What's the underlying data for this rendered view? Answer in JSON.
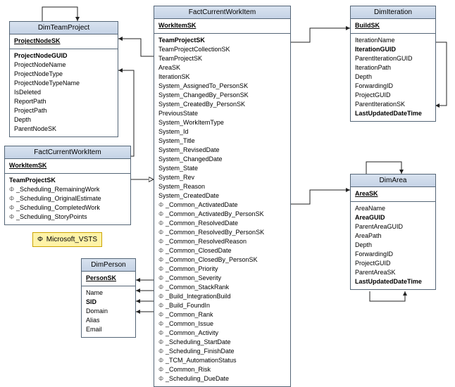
{
  "legend": {
    "phi": "Φ",
    "label": "Microsoft_VSTS"
  },
  "entities": {
    "dimTeamProject": {
      "title": "DimTeamProject",
      "pk": [
        "ProjectNodeSK"
      ],
      "fields": [
        {
          "name": "ProjectNodeGUID",
          "bold": true
        },
        {
          "name": "ProjectNodeName"
        },
        {
          "name": "ProjectNodeType"
        },
        {
          "name": "ProjectNodeTypeName"
        },
        {
          "name": "IsDeleted"
        },
        {
          "name": "ReportPath"
        },
        {
          "name": "ProjectPath"
        },
        {
          "name": "Depth"
        },
        {
          "name": "ParentNodeSK"
        }
      ]
    },
    "factCurrentWorkItemSmall": {
      "title": "FactCurrentWorkItem",
      "pk": [
        "WorkItemSK"
      ],
      "fields": [
        {
          "name": "TeamProjectSK",
          "bold": true
        },
        {
          "name": "_Scheduling_RemainingWork",
          "phi": true
        },
        {
          "name": "_Scheduling_OriginalEstimate",
          "phi": true
        },
        {
          "name": "_Scheduling_CompletedWork",
          "phi": true
        },
        {
          "name": "_Scheduling_StoryPoints",
          "phi": true
        }
      ]
    },
    "dimPerson": {
      "title": "DimPerson",
      "pk": [
        "PersonSK"
      ],
      "fields": [
        {
          "name": "Name"
        },
        {
          "name": "SID",
          "bold": true
        },
        {
          "name": "Domain"
        },
        {
          "name": "Alias"
        },
        {
          "name": "Email"
        }
      ]
    },
    "factCurrentWorkItemBig": {
      "title": "FactCurrentWorkItem",
      "pk": [
        "WorkItemSK"
      ],
      "fields": [
        {
          "name": "TeamProjectSK",
          "bold": true
        },
        {
          "name": "TeamProjectCollectionSK"
        },
        {
          "name": "TeamProjectSK"
        },
        {
          "name": "AreaSK"
        },
        {
          "name": "IterationSK"
        },
        {
          "name": "System_AssignedTo_PersonSK"
        },
        {
          "name": "System_ChangedBy_PersonSK"
        },
        {
          "name": "System_CreatedBy_PersonSK"
        },
        {
          "name": "PreviousState"
        },
        {
          "name": "System_WorkItemType"
        },
        {
          "name": "System_Id"
        },
        {
          "name": "System_Title"
        },
        {
          "name": "System_RevisedDate"
        },
        {
          "name": "System_ChangedDate"
        },
        {
          "name": "System_State"
        },
        {
          "name": "System_Rev"
        },
        {
          "name": "System_Reason"
        },
        {
          "name": "System_CreatedDate"
        },
        {
          "name": "_Common_ActivatedDate",
          "phi": true
        },
        {
          "name": "_Common_ActivatedBy_PersonSK",
          "phi": true
        },
        {
          "name": "_Common_ResolvedDate",
          "phi": true
        },
        {
          "name": "_Common_ResolvedBy_PersonSK",
          "phi": true
        },
        {
          "name": "_Common_ResolvedReason",
          "phi": true
        },
        {
          "name": "_Common_ClosedDate",
          "phi": true
        },
        {
          "name": "_Common_ClosedBy_PersonSK",
          "phi": true
        },
        {
          "name": "_Common_Priority",
          "phi": true
        },
        {
          "name": "_Common_Severity",
          "phi": true
        },
        {
          "name": "_Common_StackRank",
          "phi": true
        },
        {
          "name": "_Build_IntegrationBuild",
          "phi": true
        },
        {
          "name": "_Build_FoundIn",
          "phi": true
        },
        {
          "name": "_Common_Rank",
          "phi": true
        },
        {
          "name": "_Common_Issue",
          "phi": true
        },
        {
          "name": "_Common_Activity",
          "phi": true
        },
        {
          "name": "_Scheduling_StartDate",
          "phi": true
        },
        {
          "name": "_Scheduling_FinishDate",
          "phi": true
        },
        {
          "name": "_TCM_AutomationStatus",
          "phi": true
        },
        {
          "name": "_Common_Risk",
          "phi": true
        },
        {
          "name": "_Scheduling_DueDate",
          "phi": true
        }
      ]
    },
    "dimIteration": {
      "title": "DimIteration",
      "pk": [
        "BuildSK"
      ],
      "fields": [
        {
          "name": "IterationName"
        },
        {
          "name": "IterationGUID",
          "bold": true
        },
        {
          "name": "ParentIterationGUID"
        },
        {
          "name": "IterationPath"
        },
        {
          "name": "Depth"
        },
        {
          "name": "ForwardingID"
        },
        {
          "name": "ProjectGUID"
        },
        {
          "name": "ParentIterationSK"
        },
        {
          "name": "LastUpdatedDateTime",
          "bold": true
        }
      ]
    },
    "dimArea": {
      "title": "DimArea",
      "pk": [
        "AreaSK"
      ],
      "fields": [
        {
          "name": "AreaName"
        },
        {
          "name": "AreaGUID",
          "bold": true
        },
        {
          "name": "ParentAreaGUID"
        },
        {
          "name": "AreaPath"
        },
        {
          "name": "Depth"
        },
        {
          "name": "ForwardingID"
        },
        {
          "name": "ProjectGUID"
        },
        {
          "name": "ParentAreaSK"
        },
        {
          "name": "LastUpdatedDateTime",
          "bold": true
        }
      ]
    }
  }
}
